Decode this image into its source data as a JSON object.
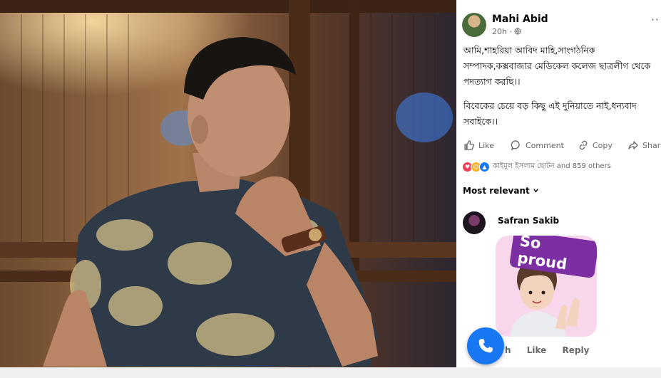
{
  "post": {
    "author": "Mahi Abid",
    "time": "20h ·",
    "more": "··",
    "paragraphs": [
      "আমি,শাহরিয়া আবিদ মাহি,সাংগঠনিক সম্পাদক,কক্সবাজার মেডিকেল কলেজ ছাত্রলীগ থেকে পদত্যাগ করছি।।",
      "বিবেকের চেয়ে বড় কিছু এই দুনিয়াতে নাই,ধন্যবাদ সবাইকে।।"
    ],
    "actions": {
      "like": "Like",
      "comment": "Comment",
      "copy": "Copy",
      "share": "Shar"
    },
    "reactions_text": "কাইমুল ইসলাম ছোটন and 859 others"
  },
  "comments": {
    "sort_label": "Most relevant",
    "first": {
      "author": "Safran Sakib",
      "sticker_text": "So proud",
      "time_fragment": "h",
      "like": "Like",
      "reply": "Reply"
    }
  },
  "icons": {
    "like": "thumbs-up-icon",
    "comment": "comment-bubble-icon",
    "copy": "link-icon",
    "share": "share-arrow-icon",
    "call": "phone-icon"
  },
  "colors": {
    "accent": "#1877f2",
    "secondary_text": "#65676b",
    "sticker_bg": "#f8d7ec",
    "sticker_label": "#7b2fa3"
  }
}
